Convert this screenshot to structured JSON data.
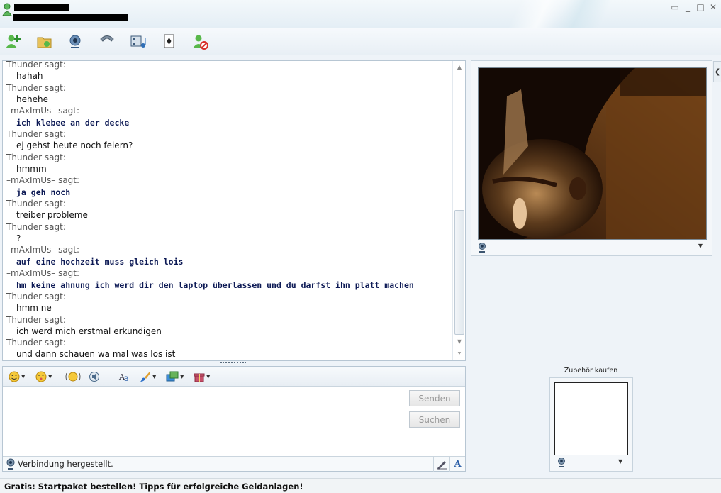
{
  "window": {
    "minimize": "_",
    "maximize": "□",
    "close": "✕",
    "restore": "▭"
  },
  "messages": [
    {
      "sender": "Thunder sagt:",
      "text": "hahah",
      "me": false
    },
    {
      "sender": "Thunder sagt:",
      "text": "hehehe",
      "me": false
    },
    {
      "sender": "–mAxImUs– sagt:",
      "text": "ich klebee an der decke",
      "me": true
    },
    {
      "sender": "Thunder sagt:",
      "text": "ej gehst heute noch feiern?",
      "me": false
    },
    {
      "sender": "Thunder sagt:",
      "text": "hmmm",
      "me": false
    },
    {
      "sender": "–mAxImUs– sagt:",
      "text": "ja geh noch",
      "me": true
    },
    {
      "sender": "Thunder sagt:",
      "text": "treiber probleme",
      "me": false
    },
    {
      "sender": "Thunder sagt:",
      "text": "?",
      "me": false
    },
    {
      "sender": "–mAxImUs– sagt:",
      "text": "auf eine hochzeit muss gleich lois",
      "me": true
    },
    {
      "sender": "–mAxImUs– sagt:",
      "text": "hm keine ahnung ich werd dir den laptop überlassen und du darfst ihn platt machen",
      "me": true
    },
    {
      "sender": "Thunder sagt:",
      "text": "hmm ne",
      "me": false
    },
    {
      "sender": "Thunder sagt:",
      "text": "ich werd mich erstmal erkundigen",
      "me": false
    },
    {
      "sender": "Thunder sagt:",
      "text": "und dann schauen wa mal was los ist",
      "me": false
    }
  ],
  "compose": {
    "send_label": "Senden",
    "search_label": "Suchen",
    "status_text": "Verbindung hergestellt.",
    "font_glyph": "A"
  },
  "accessories": {
    "label": "Zubehör kaufen"
  },
  "footer": {
    "ad_text": "Gratis: Startpaket bestellen! Tipps für erfolgreiche Geldanlagen!"
  },
  "colors": {
    "accent": "#2c5fa8",
    "my_text": "#0d1a55"
  }
}
